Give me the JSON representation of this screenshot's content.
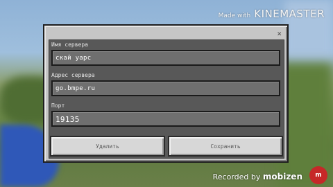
{
  "watermark": {
    "made_with": "Made with",
    "brand": "KINEMASTER"
  },
  "dialog": {
    "close_symbol": "×",
    "fields": [
      {
        "label": "Имя сервера",
        "value": "скай уарс"
      },
      {
        "label": "Адрес сервера",
        "value": "go.bmpe.ru"
      },
      {
        "label": "Порт",
        "value": "19135"
      }
    ],
    "buttons": {
      "delete": "Удалить",
      "save": "Сохранить"
    }
  },
  "recorder": {
    "recorded_by": "Recorded by",
    "brand": "mobizen",
    "logo_text": "m"
  },
  "colors": {
    "dialog_bg": "#c6c6c6",
    "form_bg": "#585858",
    "field_bg": "#6f6f6f",
    "button_bg": "#d7d7d7"
  }
}
